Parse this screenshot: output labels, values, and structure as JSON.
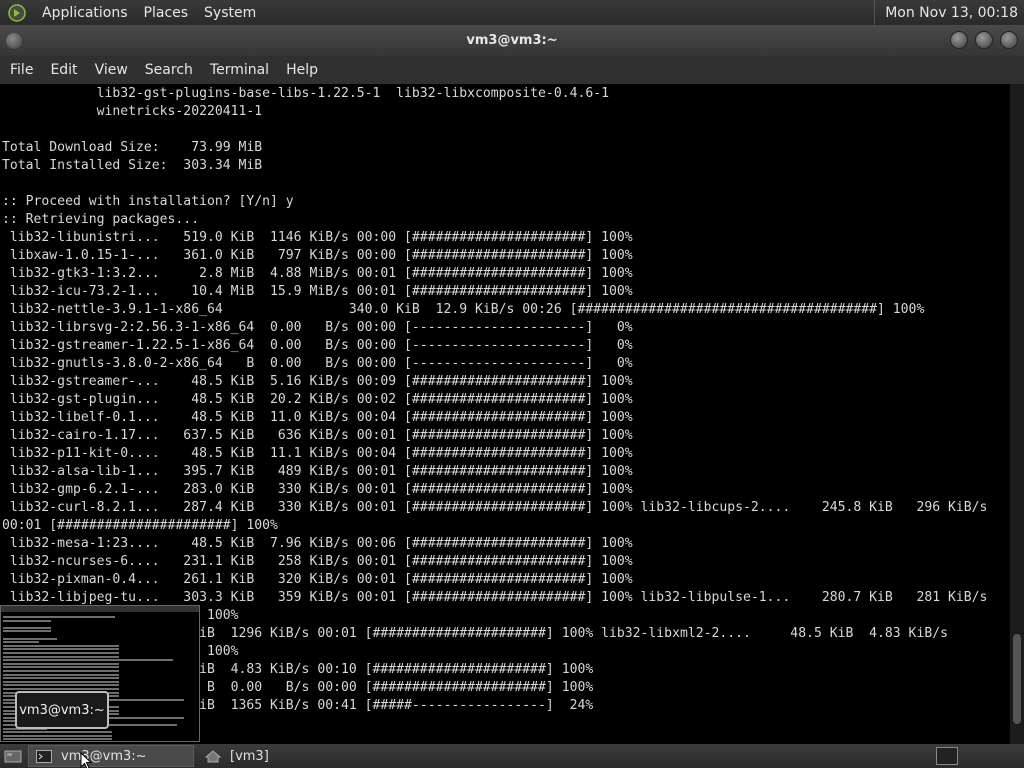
{
  "top_panel": {
    "menus": [
      "Applications",
      "Places",
      "System"
    ],
    "clock": "Mon Nov 13, 00:18"
  },
  "window": {
    "title": "vm3@vm3:~",
    "menu": [
      "File",
      "Edit",
      "View",
      "Search",
      "Terminal",
      "Help"
    ]
  },
  "terminal": {
    "lines": [
      "            lib32-gst-plugins-base-libs-1.22.5-1  lib32-libxcomposite-0.4.6-1",
      "            winetricks-20220411-1",
      "",
      "Total Download Size:    73.99 MiB",
      "Total Installed Size:  303.34 MiB",
      "",
      ":: Proceed with installation? [Y/n] y",
      ":: Retrieving packages...",
      " lib32-libunistri...   519.0 KiB  1146 KiB/s 00:00 [######################] 100%",
      " libxaw-1.0.15-1-...   361.0 KiB   797 KiB/s 00:00 [######################] 100%",
      " lib32-gtk3-1:3.2...     2.8 MiB  4.88 MiB/s 00:01 [######################] 100%",
      " lib32-icu-73.2-1...    10.4 MiB  15.9 MiB/s 00:01 [######################] 100%",
      " lib32-nettle-3.9.1-1-x86_64                340.0 KiB  12.9 KiB/s 00:26 [######################################] 100%",
      " lib32-librsvg-2:2.56.3-1-x86_64  0.00   B/s 00:00 [----------------------]   0%",
      " lib32-gstreamer-1.22.5-1-x86_64  0.00   B/s 00:00 [----------------------]   0%",
      " lib32-gnutls-3.8.0-2-x86_64   B  0.00   B/s 00:00 [----------------------]   0%",
      " lib32-gstreamer-...    48.5 KiB  5.16 KiB/s 00:09 [######################] 100%",
      " lib32-gst-plugin...    48.5 KiB  20.2 KiB/s 00:02 [######################] 100%",
      " lib32-libelf-0.1...    48.5 KiB  11.0 KiB/s 00:04 [######################] 100%",
      " lib32-cairo-1.17...   637.5 KiB   636 KiB/s 00:01 [######################] 100%",
      " lib32-p11-kit-0....    48.5 KiB  11.1 KiB/s 00:04 [######################] 100%",
      " lib32-alsa-lib-1...   395.7 KiB   489 KiB/s 00:01 [######################] 100%",
      " lib32-gmp-6.2.1-...   283.0 KiB   330 KiB/s 00:01 [######################] 100%",
      " lib32-curl-8.2.1...   287.4 KiB   330 KiB/s 00:01 [######################] 100% lib32-libcups-2....    245.8 KiB   296 KiB/s",
      "00:01 [######################] 100%",
      " lib32-mesa-1:23....    48.5 KiB  7.96 KiB/s 00:06 [######################] 100%",
      " lib32-ncurses-6....   231.1 KiB   258 KiB/s 00:01 [######################] 100%",
      " lib32-pixman-0.4...   261.1 KiB   320 KiB/s 00:01 [######################] 100%",
      " lib32-libjpeg-tu...   303.3 KiB   359 KiB/s 00:01 [######################] 100% lib32-libpulse-1...    280.7 KiB   281 KiB/s",
      "                    ####] 100%",
      "                    3.2 KiB  1296 KiB/s 00:01 [######################] 100% lib32-libxml2-2....     48.5 KiB  4.83 KiB/s",
      "                    ####] 100%",
      "                    8.5 KiB  4.83 KiB/s 00:10 [######################] 100%",
      "                    0.0   B  0.00   B/s 00:00 [######################] 100%",
      "                    8.2 MiB  1365 KiB/s 00:41 [#####-----------------]  24%"
    ]
  },
  "bottom_panel": {
    "tasks": [
      {
        "label": "vm3@vm3:~",
        "active": true
      },
      {
        "label": "[vm3]",
        "active": false
      }
    ]
  },
  "preview_tooltip": "vm3@vm3:~",
  "colors": {
    "terminal_bg": "#000000",
    "terminal_fg": "#d8d8d8",
    "panel_bg": "#2f2f2f"
  }
}
